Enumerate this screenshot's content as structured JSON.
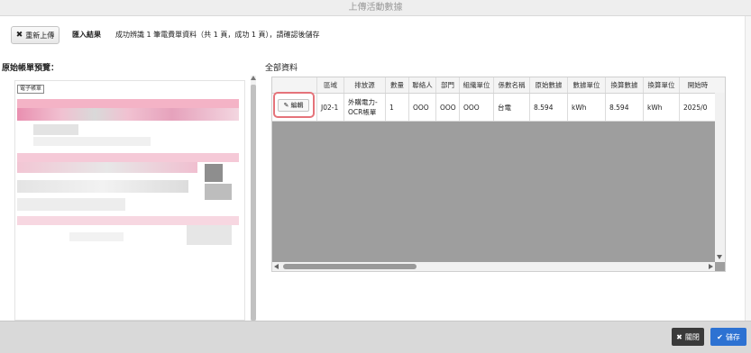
{
  "window": {
    "title": "上傳活動數據"
  },
  "toolbar": {
    "reupload_label": "重新上傳",
    "import_label": "匯入結果",
    "import_message": "成功辨識 1 筆電費單資料（共 1 頁，成功 1 頁），請確認後儲存"
  },
  "left_panel": {
    "title": "原始帳單預覽：",
    "doc_tag": "電子帳單"
  },
  "right_panel": {
    "title": "全部資料",
    "columns": [
      "",
      "區域",
      "排放源",
      "數量",
      "聯絡人",
      "部門",
      "組織單位",
      "係數名稱",
      "原始數據",
      "數據單位",
      "換算數據",
      "換算單位",
      "開始時"
    ],
    "row": {
      "edit_label": "編輯",
      "region": "J02-1",
      "source_line1": "外購電力-",
      "source_line2": "OCR帳單",
      "quantity": "1",
      "contact": "OOO",
      "department": "OOO",
      "org_unit": "OOO",
      "coefficient": "台電",
      "raw_value": "8.594",
      "raw_unit": "kWh",
      "converted_value": "8.594",
      "converted_unit": "kWh",
      "start": "2025/0"
    }
  },
  "footer": {
    "close_label": "關閉",
    "save_label": "儲存"
  },
  "colors": {
    "save": "#2d72d2",
    "close": "#3a3a3a",
    "highlight": "#e5737a"
  }
}
